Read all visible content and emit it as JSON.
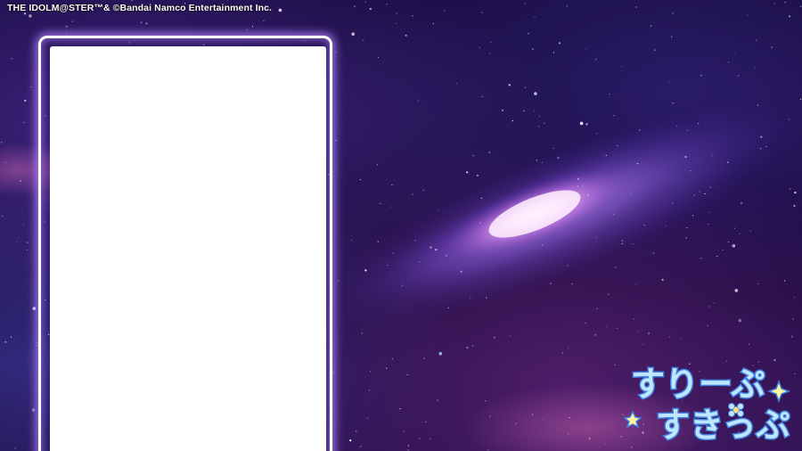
{
  "copyright": "THE IDOLM@STER™& ©Bandai Namco Entertainment Inc.",
  "logo": {
    "line1": "すりーぷ",
    "line2": "すきっぷ"
  },
  "colors": {
    "space_dark": "#150a35",
    "frame_glow": "#b482ff",
    "frame_panel": "#ffffff",
    "logo_fill": "#bfe6ff",
    "logo_outline": "#3f7fe0"
  },
  "icons": [
    "sparkle-icon",
    "star-icon",
    "flower-icon"
  ]
}
